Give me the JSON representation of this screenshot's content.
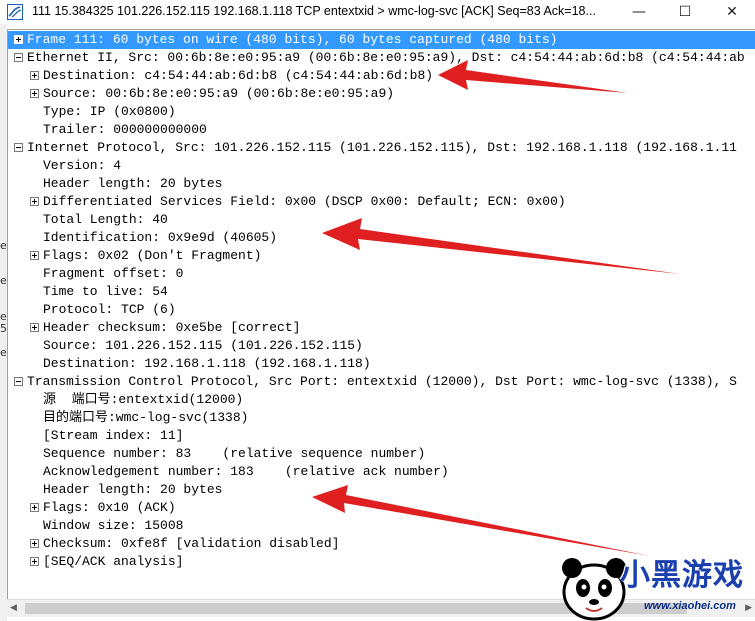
{
  "window": {
    "title": "111 15.384325 101.226.152.115 192.168.1.118 TCP entextxid > wmc-log-svc [ACK] Seq=83 Ack=18...",
    "minimize_glyph": "—",
    "maximize_glyph": "☐",
    "close_glyph": "✕"
  },
  "left_strip": [
    "e",
    "e",
    "e",
    "5",
    "e"
  ],
  "tree": {
    "rows": [
      {
        "text": "Frame 111: 60 bytes on wire (480 bits), 60 bytes captured (480 bits)",
        "level": 0,
        "expander": "plus",
        "selected": true
      },
      {
        "text": "Ethernet II, Src: 00:6b:8e:e0:95:a9 (00:6b:8e:e0:95:a9), Dst: c4:54:44:ab:6d:b8 (c4:54:44:ab",
        "level": 0,
        "expander": "minus",
        "selected": false
      },
      {
        "text": "Destination: c4:54:44:ab:6d:b8 (c4:54:44:ab:6d:b8)",
        "level": 1,
        "expander": "plus",
        "selected": false
      },
      {
        "text": "Source: 00:6b:8e:e0:95:a9 (00:6b:8e:e0:95:a9)",
        "level": 1,
        "expander": "plus",
        "selected": false
      },
      {
        "text": "Type: IP (0x0800)",
        "level": 1,
        "expander": "",
        "selected": false
      },
      {
        "text": "Trailer: 000000000000",
        "level": 1,
        "expander": "",
        "selected": false
      },
      {
        "text": "Internet Protocol, Src: 101.226.152.115 (101.226.152.115), Dst: 192.168.1.118 (192.168.1.11",
        "level": 0,
        "expander": "minus",
        "selected": false
      },
      {
        "text": "Version: 4",
        "level": 1,
        "expander": "",
        "selected": false
      },
      {
        "text": "Header length: 20 bytes",
        "level": 1,
        "expander": "",
        "selected": false
      },
      {
        "text": "Differentiated Services Field: 0x00 (DSCP 0x00: Default; ECN: 0x00)",
        "level": 1,
        "expander": "plus",
        "selected": false
      },
      {
        "text": "Total Length: 40",
        "level": 1,
        "expander": "",
        "selected": false
      },
      {
        "text": "Identification: 0x9e9d (40605)",
        "level": 1,
        "expander": "",
        "selected": false
      },
      {
        "text": "Flags: 0x02 (Don't Fragment)",
        "level": 1,
        "expander": "plus",
        "selected": false
      },
      {
        "text": "Fragment offset: 0",
        "level": 1,
        "expander": "",
        "selected": false
      },
      {
        "text": "Time to live: 54",
        "level": 1,
        "expander": "",
        "selected": false
      },
      {
        "text": "Protocol: TCP (6)",
        "level": 1,
        "expander": "",
        "selected": false
      },
      {
        "text": "Header checksum: 0xe5be [correct]",
        "level": 1,
        "expander": "plus",
        "selected": false
      },
      {
        "text": "Source: 101.226.152.115 (101.226.152.115)",
        "level": 1,
        "expander": "",
        "selected": false
      },
      {
        "text": "Destination: 192.168.1.118 (192.168.1.118)",
        "level": 1,
        "expander": "",
        "selected": false
      },
      {
        "text": "Transmission Control Protocol, Src Port: entextxid (12000), Dst Port: wmc-log-svc (1338), S",
        "level": 0,
        "expander": "minus",
        "selected": false
      },
      {
        "text": "源  端口号:entextxid(12000)",
        "level": 1,
        "expander": "",
        "selected": false
      },
      {
        "text": "目的端口号:wmc-log-svc(1338)",
        "level": 1,
        "expander": "",
        "selected": false
      },
      {
        "text": "[Stream index: 11]",
        "level": 1,
        "expander": "",
        "selected": false
      },
      {
        "text": "Sequence number: 83    (relative sequence number)",
        "level": 1,
        "expander": "",
        "selected": false
      },
      {
        "text": "Acknowledgement number: 183    (relative ack number)",
        "level": 1,
        "expander": "",
        "selected": false
      },
      {
        "text": "Header length: 20 bytes",
        "level": 1,
        "expander": "",
        "selected": false
      },
      {
        "text": "Flags: 0x10 (ACK)",
        "level": 1,
        "expander": "plus",
        "selected": false
      },
      {
        "text": "Window size: 15008",
        "level": 1,
        "expander": "",
        "selected": false
      },
      {
        "text": "Checksum: 0xfe8f [validation disabled]",
        "level": 1,
        "expander": "plus",
        "selected": false
      },
      {
        "text": "[SEQ/ACK analysis]",
        "level": 1,
        "expander": "plus",
        "selected": false
      }
    ]
  },
  "annotations": {
    "arrow_color": "#e02020",
    "arrow_count": 3
  },
  "watermark": {
    "brand": "小黑游戏",
    "url": "www.xiaohei.com"
  },
  "colors": {
    "selection": "#3399ff",
    "arrow": "#e02020",
    "watermark_text": "#1a3fae"
  }
}
